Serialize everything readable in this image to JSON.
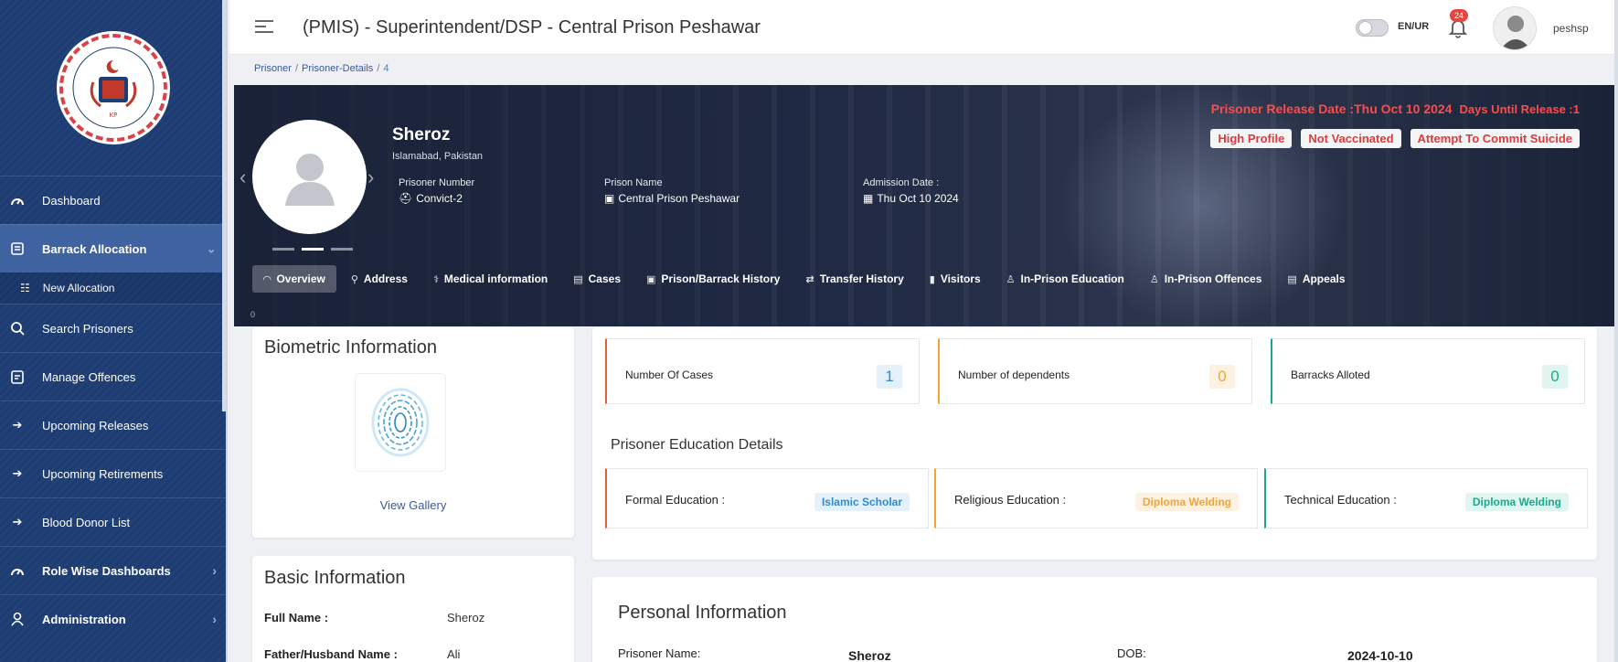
{
  "sidebar": {
    "logo_text": "KHYBER PAKHTUNKHWA",
    "items": [
      {
        "label": "Dashboard",
        "icon": "gauge-icon"
      },
      {
        "label": "Barrack Allocation",
        "icon": "building-icon"
      },
      {
        "label": "New Allocation",
        "icon": "list-icon"
      },
      {
        "label": "Search Prisoners",
        "icon": "search-icon"
      },
      {
        "label": "Manage Offences",
        "icon": "clipboard-icon"
      },
      {
        "label": "Upcoming Releases",
        "icon": "arrow-right-icon"
      },
      {
        "label": "Upcoming Retirements",
        "icon": "arrow-right-icon"
      },
      {
        "label": "Blood Donor List",
        "icon": "arrow-right-icon"
      },
      {
        "label": "Role Wise Dashboards",
        "icon": "gauge-icon"
      },
      {
        "label": "Administration",
        "icon": "user-icon"
      }
    ]
  },
  "header": {
    "title": "(PMIS) - Superintendent/DSP - Central Prison Peshawar",
    "lang_toggle": "EN/UR",
    "notification_count": "24",
    "username": "peshsp"
  },
  "breadcrumb": [
    "Prisoner",
    "Prisoner-Details",
    "4"
  ],
  "profile": {
    "name": "Sheroz",
    "location": "Islamabad, Pakistan",
    "prisoner_number_label": "Prisoner Number",
    "prisoner_number": "Convict-2",
    "prison_name_label": "Prison Name",
    "prison_name": "Central Prison Peshawar",
    "admission_label": "Admission Date :",
    "admission_date": "Thu Oct 10 2024",
    "release_label": "Prisoner Release Date :Thu Oct 10 2024",
    "days_until": "Days Until Release :1",
    "tags": [
      "High Profile",
      "Not Vaccinated",
      "Attempt To Commit Suicide"
    ],
    "zero": "0"
  },
  "tabs": [
    {
      "label": "Overview",
      "icon": "gauge-icon"
    },
    {
      "label": "Address",
      "icon": "pin-icon"
    },
    {
      "label": "Medical information",
      "icon": "medical-icon"
    },
    {
      "label": "Cases",
      "icon": "folder-icon"
    },
    {
      "label": "Prison/Barrack History",
      "icon": "building-icon"
    },
    {
      "label": "Transfer History",
      "icon": "transfer-icon"
    },
    {
      "label": "Visitors",
      "icon": "badge-icon"
    },
    {
      "label": "In-Prison Education",
      "icon": "user-icon"
    },
    {
      "label": "In-Prison Offences",
      "icon": "user-icon"
    },
    {
      "label": "Appeals",
      "icon": "document-icon"
    }
  ],
  "biometric": {
    "title": "Biometric Information",
    "gallery_label": "View Gallery"
  },
  "basic": {
    "title": "Basic Information",
    "rows": [
      {
        "key": "Full Name :",
        "value": "Sheroz"
      },
      {
        "key": "Father/Husband Name :",
        "value": "Ali"
      }
    ]
  },
  "stats": [
    {
      "label": "Number Of Cases",
      "value": "1",
      "color": "#e2613a",
      "num_color": "#2e8bd0",
      "num_bg": "#e4f1fb"
    },
    {
      "label": "Number of dependents",
      "value": "0",
      "color": "#f0a537",
      "num_color": "#f0a537",
      "num_bg": "#fdf1e1"
    },
    {
      "label": "Barracks Alloted",
      "value": "0",
      "color": "#1aa98b",
      "num_color": "#1aa98b",
      "num_bg": "#e0f5ef"
    }
  ],
  "education": {
    "title": "Prisoner Education Details",
    "items": [
      {
        "label": "Formal Education :",
        "value": "Islamic Scholar",
        "color": "#e2613a",
        "pill_color": "#2e8bd0",
        "pill_bg": "#e4f1fb"
      },
      {
        "label": "Religious Education :",
        "value": "Diploma Welding",
        "color": "#f0a537",
        "pill_color": "#f0a537",
        "pill_bg": "#fdf1e1"
      },
      {
        "label": "Technical Education :",
        "value": "Diploma Welding",
        "color": "#1aa98b",
        "pill_color": "#1aa98b",
        "pill_bg": "#e0f5ef"
      }
    ]
  },
  "personal": {
    "title": "Personal Information",
    "name_label": "Prisoner Name:",
    "name_value": "Sheroz",
    "dob_label": "DOB:",
    "dob_value": "2024-10-10"
  }
}
